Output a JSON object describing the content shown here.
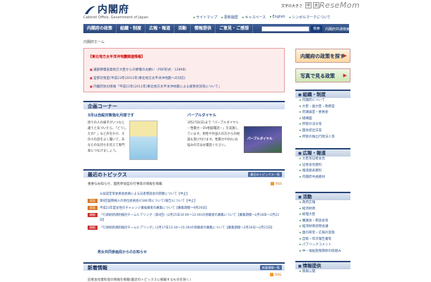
{
  "header": {
    "site_name": "内閣府",
    "site_name_en": "Cabinet Office, Government of Japan",
    "font_size_label": "文字の大きさ",
    "watermark": "ReseMom",
    "util_links": [
      "サイトマップ",
      "更新履歴",
      "キャスペース",
      "English",
      "シンボルマークについて"
    ]
  },
  "gnav": {
    "items": [
      "内閣府の政策",
      "組織・制度",
      "広報・報道",
      "活動",
      "情報提供",
      "ご意見・ご感想"
    ],
    "search_button": "検索",
    "related_link": "内閣府共通検索"
  },
  "breadcrumb": "内閣府ホーム",
  "notice": {
    "title": "【東北地方太平洋沖地震関連情報】",
    "items": [
      "議部節電安発地方大臣からの節電のお願い（PDF形式：128KB）",
      "官邸対策室(平成23年(2011年)東北地方太平洋沖地震への対応)",
      "内閣府防災情報「平成23年(2011年)東北地方太平洋沖地震による被害状況等について」"
    ]
  },
  "kikaku": {
    "title": "企画コーナー",
    "left_title": "3月は自殺対策強化月間です",
    "left_text": "周りの人の様子がいつもと違うと気づいたら、「どうしたの？」など声をかけ、その人の話をよく聞いて、あなたの気持ちを伝えて専門家につなげましょう。",
    "right_title": "パープルダイヤル",
    "right_text": "3月27日(日)まで「パープルダイヤル－性暴力・DV相談電話－」を実施しています。男性や外国人の方からの相談も受け付けます。性暴力やDVにお悩みの方はお電話ください。",
    "right_img_label": "パープルダイヤル"
  },
  "topics": {
    "title": "最近のトピックス",
    "more": "最近のトピックス一覧",
    "intro": "重要なお知らせ、国民参加型の行事等の情報を掲載",
    "rss": "RSS",
    "rows": [
      {
        "tag": "",
        "text": "公益認定等委員会委員による記者懇談会の開催について【中止】",
        "color": ""
      },
      {
        "tag": "男女",
        "text": "第6回国際婦人の地位委員会(CSW)等について(報告)について【中止】",
        "color": "#d87b2a"
      },
      {
        "tag": "男女",
        "text": "平成23年度女性のチャレンジ賞候補者の募集について【募集期間～9月26日】",
        "color": "#d87b2a"
      },
      {
        "tag": "刷新",
        "text": "「行政刷新規制検討チームヒアリング（第4回）(2月25日10:00～12:00)の傍聴者の募集について【募集期間～2月18日～2月22日】",
        "color": "#c33"
      },
      {
        "tag": "刷新",
        "text": "「行政刷新規制検討チームヒアリング」(2月17日13:30～15:30)の傍聴者の募集について【募集期間～2月16日～2月15日】",
        "color": "#c33"
      }
    ],
    "bottom_link": "男女共同参画局からのお知らせ"
  },
  "shinchaku": {
    "title": "新着情報",
    "more": "新着情報一覧",
    "rss": "RSS",
    "intro": "記者会見資料等の情報を掲載(最近のトピックスに掲載するものを除く)"
  },
  "sidebar": {
    "banner1": "内閣府の政策を探す",
    "banner2": "写真で見る政策",
    "groups": [
      {
        "title": "組織・制度",
        "links": [
          "内閣府について",
          "大臣・副大臣・政務官",
          "府議論室・委員会",
          "組織図",
          "所管の法令等",
          "国会提出法案",
          "所管の独立行政法人等"
        ]
      },
      {
        "title": "広報・報道",
        "links": [
          "大臣等記者会見",
          "記者会見資料",
          "報道発表資料",
          "内閣府共通素材"
        ]
      },
      {
        "title": "活動",
        "links": [
          "政府広報",
          "経済財政",
          "総理大臣",
          "審議会・懇談会等",
          "経済財政諮問会議",
          "国の研究・広報の実施",
          "自衛・年次報告書等",
          "パブリックコメント",
          "中・福祉施策関係の取組み"
        ]
      },
      {
        "title": "情報提供",
        "links": [
          "情報公開"
        ]
      }
    ]
  },
  "colors": {
    "nav": "#2a477a",
    "notice_bg": "#fdecec",
    "link": "#2a4f8a"
  }
}
